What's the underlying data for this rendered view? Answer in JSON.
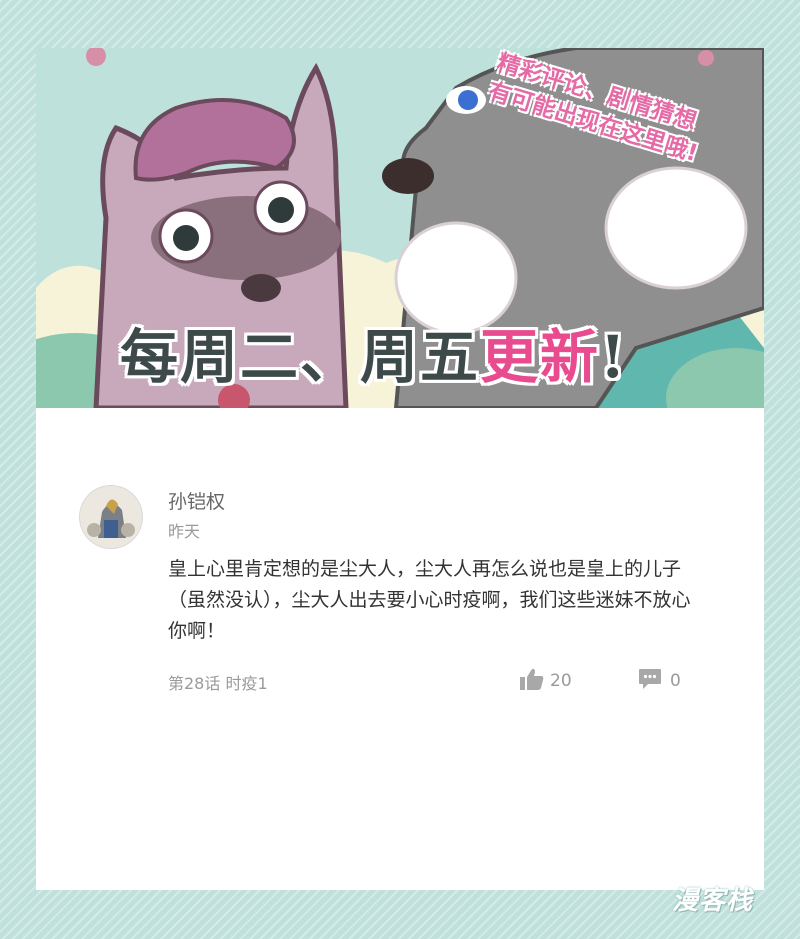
{
  "banner": {
    "promo_line1": "精彩评论、剧情猜想",
    "promo_line2": "有可能出现在这里哦!",
    "announce_main": "每周二、周五",
    "announce_highlight": "更新",
    "announce_end": "!"
  },
  "comment": {
    "username": "孙铠权",
    "time": "昨天",
    "text": "皇上心里肯定想的是尘大人，尘大人再怎么说也是皇上的儿子（虽然没认），尘大人出去要小心时疫啊，我们这些迷妹不放心你啊！",
    "chapter": "第28话 时疫1",
    "likes": "20",
    "replies": "0"
  },
  "watermark": "漫客栈",
  "colors": {
    "background": "#bfe0db",
    "highlight": "#e94b8f",
    "promo": "#e56aa6",
    "meta_text": "#9a9a9a"
  },
  "icons": [
    "thumbs-up-icon",
    "comment-bubble-icon"
  ]
}
